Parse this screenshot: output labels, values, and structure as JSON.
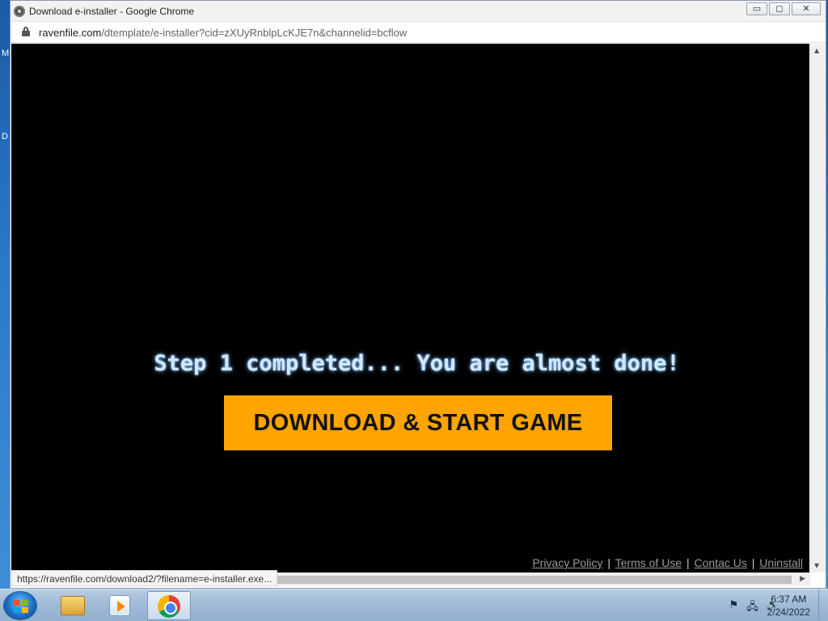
{
  "desktop": {
    "letters": [
      "M",
      "D"
    ]
  },
  "browser": {
    "title": "Download e-installer - Google Chrome",
    "window_buttons": {
      "minimize": "▭",
      "maximize": "◻",
      "close": "✕"
    },
    "url_host": "ravenfile.com",
    "url_path": "/dtemplate/e-installer?cid=zXUyRnblpLcKJE7n&channelid=bcflow"
  },
  "page": {
    "step_text": "Step 1 completed... You are almost done!",
    "cta_label": "DOWNLOAD & START GAME",
    "footer": {
      "links": [
        "Privacy Policy",
        "Terms of Use",
        "Contac Us",
        "Uninstall"
      ],
      "separator": "|"
    },
    "status_url": "https://ravenfile.com/download2/?filename=e-installer.exe..."
  },
  "taskbar": {
    "items": [
      "windows-explorer",
      "media-player",
      "google-chrome"
    ],
    "tray_icons": [
      "action-center-flag-icon",
      "network-icon",
      "volume-icon"
    ],
    "time": "6:37 AM",
    "date": "2/24/2022"
  },
  "colors": {
    "page_bg": "#000000",
    "cta_bg": "#ffa400",
    "step_text": "#cfe8ff"
  }
}
